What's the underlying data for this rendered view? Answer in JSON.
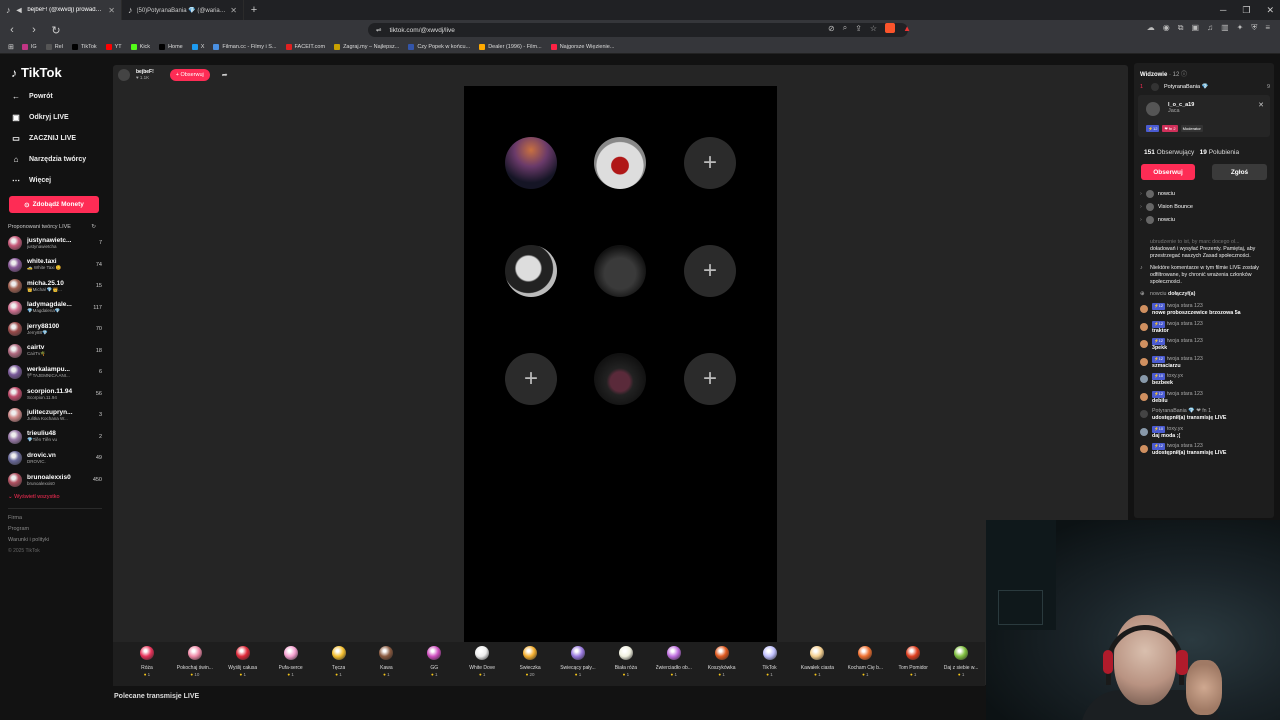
{
  "browser": {
    "tabs": [
      {
        "title": "bejbeF! (@xwvdj) prowadzi LI",
        "active": true
      },
      {
        "title": "(50)PotyranaBania 💎 (@wariacikp...",
        "active": false
      }
    ],
    "url": "tiktok.com/@xwvdj/live",
    "bookmarks": [
      "IG",
      "Rel",
      "TikTok",
      "YT",
      "Kick",
      "Home",
      "X",
      "Filman.cc - Filmy i S...",
      "FACEIT.com",
      "Zagraj.my – Najlepsz...",
      "Czy Popek w końcu...",
      "Dealer (1996) - Film...",
      "Najgorsze Więzienie..."
    ],
    "bookmark_colors": [
      "#c13584",
      "#555555",
      "#000000",
      "#ff0000",
      "#53fc18",
      "#000000",
      "#1d9bf0",
      "#4a90e2",
      "#e02020",
      "#c8a000",
      "#3355aa",
      "#ffaa00",
      "#ff2244"
    ]
  },
  "sidebar": {
    "logo": "TikTok",
    "nav": [
      {
        "label": "Powrót",
        "icon": "back-arrow-icon",
        "glyph": "←"
      },
      {
        "label": "Odkryj LIVE",
        "icon": "live-icon",
        "glyph": "▣"
      },
      {
        "label": "ZACZNIJ LIVE",
        "icon": "camera-icon",
        "glyph": "▭"
      },
      {
        "label": "Narzędzia twórcy",
        "icon": "creator-tools-icon",
        "glyph": "⌂"
      },
      {
        "label": "Więcej",
        "icon": "more-icon",
        "glyph": "⋯"
      }
    ],
    "coins_button": "Zdobądź Monety",
    "suggested_header": "Proponowani twórcy LIVE",
    "creators": [
      {
        "name": "justynawietc...",
        "sub": "justynawietcha",
        "count": "7",
        "color": "#c85a7a"
      },
      {
        "name": "white.taxi",
        "sub": "🚕 White Taxi 😊",
        "count": "74",
        "color": "#8a5a9a"
      },
      {
        "name": "micha.25.10",
        "sub": "👑Michał 💎👑...",
        "count": "15",
        "color": "#a06050"
      },
      {
        "name": "ladymagdale...",
        "sub": "💎Magdalena💎",
        "count": "117",
        "color": "#d07090"
      },
      {
        "name": "jerry88100",
        "sub": "Jerry88💎",
        "count": "70",
        "color": "#9a4a4a"
      },
      {
        "name": "cairtv",
        "sub": "CairTv🌴",
        "count": "18",
        "color": "#b06a80"
      },
      {
        "name": "werkalampu...",
        "sub": "🏴TAJEMNICA ANI...",
        "count": "6",
        "color": "#7a5a9a"
      },
      {
        "name": "scorpion.11.94",
        "sub": "Scorpion.11.94",
        "count": "56",
        "color": "#c04a6a"
      },
      {
        "name": "juliteczupryn...",
        "sub": "Julitka Kochana W...",
        "count": "3",
        "color": "#d08a8a"
      },
      {
        "name": "trieuliu48",
        "sub": "💎Tiền Tiền vu",
        "count": "2",
        "color": "#9a7aaa"
      },
      {
        "name": "drovic.vn",
        "sub": "DROVIC.",
        "count": "49",
        "color": "#6a6a9a"
      },
      {
        "name": "brunoalexxis0",
        "sub": "brunoalexxis0",
        "count": "450",
        "color": "#b05060"
      }
    ],
    "show_all": "⌄ Wyświetl wszystko",
    "footer": [
      "Firma",
      "Program",
      "Warunki i polityki"
    ],
    "copyright": "© 2025 TikTok"
  },
  "stream": {
    "host_name": "bejbeF!",
    "host_likes": "♥ 1.1K",
    "follow_button": "+ Obserwuj",
    "slots": [
      {
        "type": "photo1",
        "label": ""
      },
      {
        "type": "photo2",
        "label": ""
      },
      {
        "type": "empty",
        "label": "+"
      },
      {
        "type": "photo3",
        "label": ""
      },
      {
        "type": "photo4",
        "label": ""
      },
      {
        "type": "empty",
        "label": "+"
      },
      {
        "type": "empty",
        "label": "+"
      },
      {
        "type": "photo5",
        "label": ""
      },
      {
        "type": "empty",
        "label": "+"
      }
    ],
    "recommended": "Polecane transmisje LIVE"
  },
  "gifts": [
    {
      "name": "Róża",
      "price": "1",
      "color": "#e8335a"
    },
    {
      "name": "Pokochaj świn...",
      "price": "10",
      "color": "#f08aa8"
    },
    {
      "name": "Wyślij całusa",
      "price": "1",
      "color": "#e02a3a"
    },
    {
      "name": "Pufa-serce",
      "price": "1",
      "color": "#f5a0d0"
    },
    {
      "name": "Tęcza",
      "price": "1",
      "color": "#f5c030"
    },
    {
      "name": "Kawa",
      "price": "1",
      "color": "#8a5a40"
    },
    {
      "name": "GG",
      "price": "1",
      "color": "#d050c0"
    },
    {
      "name": "White Dove",
      "price": "1",
      "color": "#eeeeee"
    },
    {
      "name": "Świeczka",
      "price": "20",
      "color": "#f5b030"
    },
    {
      "name": "Świecący pały...",
      "price": "1",
      "color": "#9a7ae0"
    },
    {
      "name": "Biała róża",
      "price": "1",
      "color": "#f0f0e0"
    },
    {
      "name": "Zwierciadło ob...",
      "price": "1",
      "color": "#c070e0"
    },
    {
      "name": "Koszykówka",
      "price": "1",
      "color": "#e05a20"
    },
    {
      "name": "TikTok",
      "price": "1",
      "color": "#c0c0ff"
    },
    {
      "name": "Kawałek ciasta",
      "price": "1",
      "color": "#f5d090"
    },
    {
      "name": "Kocham Cię b...",
      "price": "1",
      "color": "#f07030"
    },
    {
      "name": "Tom Pomidor",
      "price": "1",
      "color": "#e04020"
    },
    {
      "name": "Daj z siebie w...",
      "price": "1",
      "color": "#80c040"
    }
  ],
  "viewers": {
    "header": "Widzowie",
    "count": "· 12 ⓘ",
    "top": {
      "rank": "1",
      "name": "PotyranaBania 💎",
      "score": "9"
    },
    "profile": {
      "name": "l_o_c_a19",
      "sub": "Jaca",
      "badges": [
        "⚡12",
        "❤ fn 2",
        "Moderator"
      ],
      "followers": "151",
      "followers_label": "Obserwujący",
      "likes": "19",
      "likes_label": "Polubienia",
      "follow_btn": "Obserwuj",
      "report_btn": "Zgłoś"
    },
    "list": [
      "nowciu",
      "Vision Bounce",
      "nowciu"
    ]
  },
  "chat": {
    "faded": "ubrudzenie to ist, by marc docego ol...",
    "system1": "doładowań i wysyłać Prezenty. Pamiętaj, aby przestrzegać naszych Zasad społeczności.",
    "system2": "Niektóre komentarze w tym filmie LIVE zostały odfiltrowane, by chronić wrażenia członków społeczności.",
    "joined_user": "nowciu",
    "joined_text": "dołączył(a)",
    "messages": [
      {
        "user": "twoja stara 123",
        "level": "⚡12",
        "text": "nowe proboszczewice brzozowa 5a",
        "color": "#d09060"
      },
      {
        "user": "twoja stara 123",
        "level": "⚡12",
        "text": "traktor",
        "color": "#d09060"
      },
      {
        "user": "twoja stara 123",
        "level": "⚡12",
        "text": "3pekk",
        "color": "#d09060"
      },
      {
        "user": "twoja stara 123",
        "level": "⚡12",
        "text": "szmaciarzu",
        "color": "#d09060"
      },
      {
        "user": "toxy.yx",
        "level": "⚡10",
        "text": "bezbeek",
        "color": "#8899aa"
      },
      {
        "user": "twoja stara 123",
        "level": "⚡12",
        "text": "debilu",
        "color": "#d09060"
      },
      {
        "user": "PotyranaBania 💎 ❤ fn 1",
        "level": "",
        "text": "udostępnił(a) transmisję LIVE",
        "color": "#444444"
      },
      {
        "user": "toxy.yx",
        "level": "⚡10",
        "text": "daj moda ;(",
        "color": "#8899aa"
      },
      {
        "user": "twoja stara 123",
        "level": "⚡12",
        "text": "udostępnił(a) transmisję LIVE",
        "color": "#d09060"
      }
    ]
  }
}
